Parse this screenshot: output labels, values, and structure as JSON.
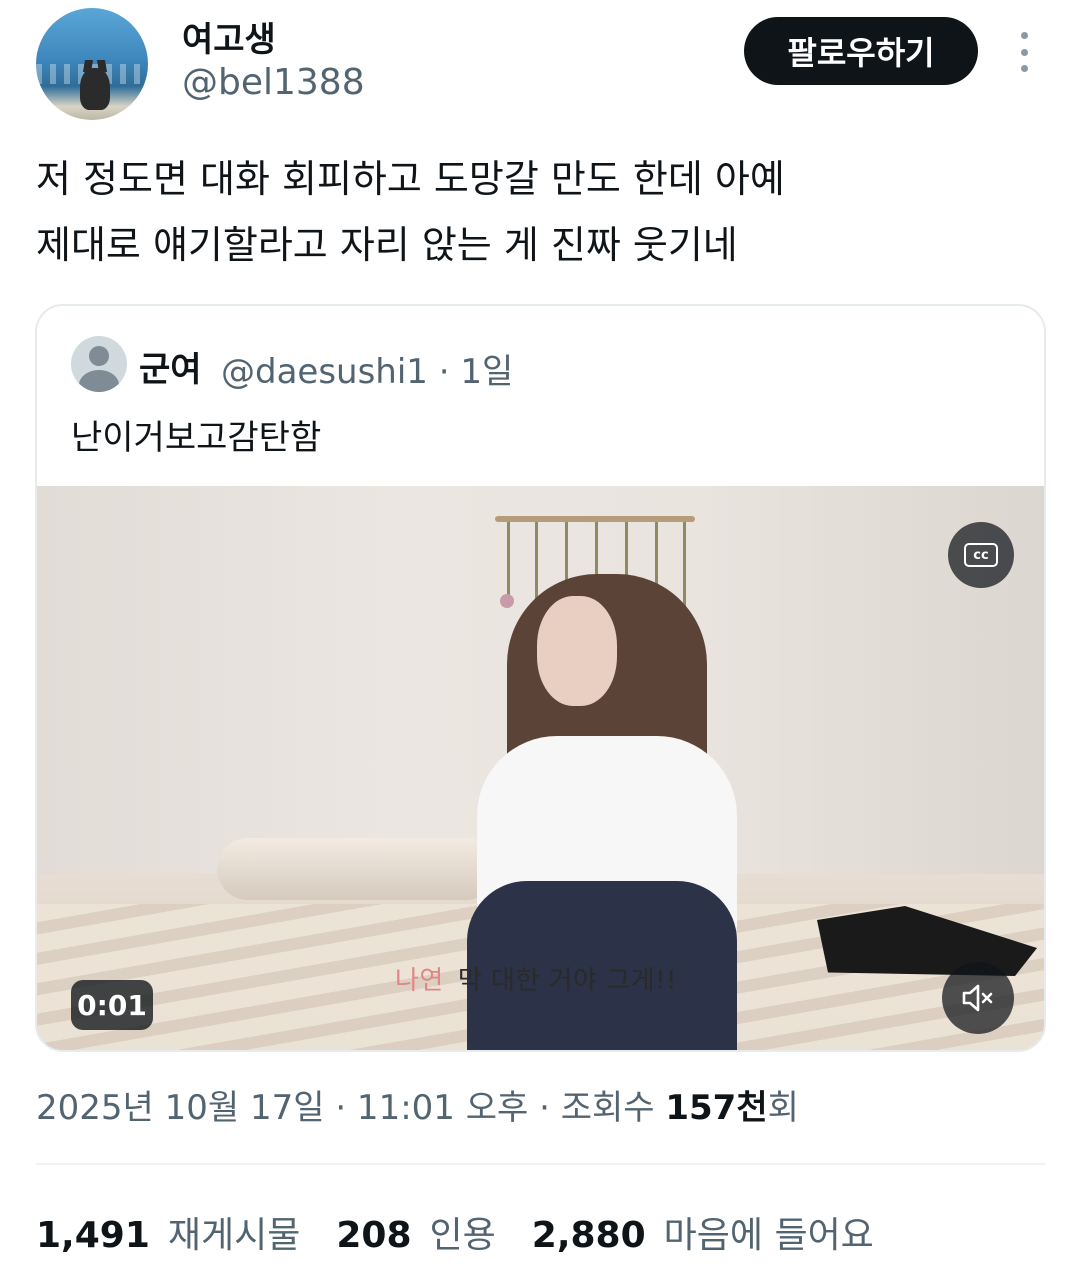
{
  "author": {
    "display_name": "여고생",
    "handle": "@bel1388",
    "follow_label": "팔로우하기"
  },
  "tweet": {
    "line1": "저 정도면 대화 회피하고 도망갈 만도 한데 아예",
    "line2": "제대로 얘기할라고 자리 앉는 게 진짜 웃기네"
  },
  "quote": {
    "name": "군여",
    "handle_time": "@daesushi1 · 1일",
    "text": "난이거보고감탄함",
    "video": {
      "subtitle_speaker": "나연",
      "subtitle_text": "막 대한 거야 그게!!",
      "cc_label": "cc",
      "time": "0:01"
    }
  },
  "meta": {
    "date_time": "2025년 10월 17일 · 11:01 오후 · 조회수 ",
    "views_value": "157천",
    "views_suffix": "회"
  },
  "stats": [
    {
      "value": "1,491",
      "label": "재게시물"
    },
    {
      "value": "208",
      "label": "인용"
    },
    {
      "value": "2,880",
      "label": "마음에 들어요"
    }
  ],
  "colors": {
    "text_primary": "#0f1419",
    "text_secondary": "#536471",
    "button_bg": "#0f1419"
  }
}
